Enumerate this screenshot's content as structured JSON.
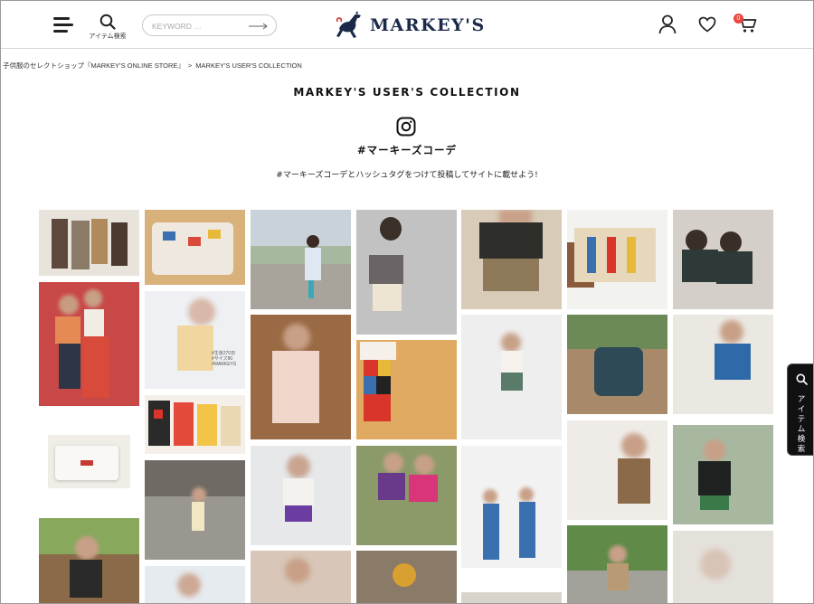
{
  "header": {
    "item_search_label": "アイテム検索",
    "keyword_placeholder": "KEYWORD …",
    "logo_text": "MARKEY'S",
    "cart_count": "0"
  },
  "breadcrumb": {
    "home": "子供服のセレクトショップ『MARKEY'S ONLINE STORE』",
    "separator": ">",
    "current": "MARKEY'S USER'S COLLECTION"
  },
  "page": {
    "title": "MARKEY'S USER'S COLLECTION",
    "hashtag": "#マーキーズコーデ",
    "lead": "#マーキーズコーデとハッシュタグをつけて投稿してサイトに載せよう!"
  },
  "photos": [
    {
      "caption": ""
    },
    {
      "caption": "#生後270日\n#サイズ80\n#MARKEYS"
    }
  ],
  "side_tab": {
    "label": "アイテム検索"
  },
  "colors": {
    "accent": "#e8463f",
    "logo": "#1c2a4a"
  }
}
